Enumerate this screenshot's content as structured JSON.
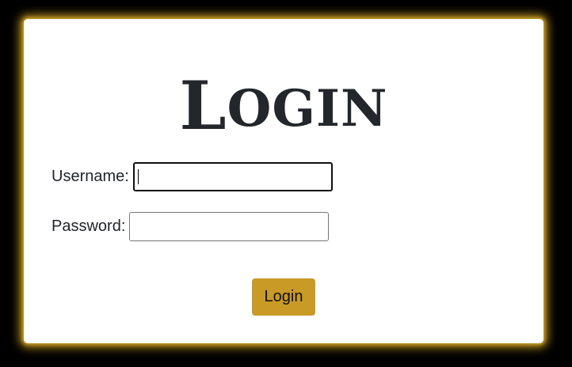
{
  "form": {
    "title_first": "L",
    "title_rest": "OGIN",
    "username_label": "Username:",
    "username_value": "",
    "password_label": "Password:",
    "password_value": "",
    "submit_label": "Login"
  },
  "colors": {
    "background": "#000000",
    "card": "#ffffff",
    "glow": "#daaa20",
    "button": "#c99a26"
  }
}
